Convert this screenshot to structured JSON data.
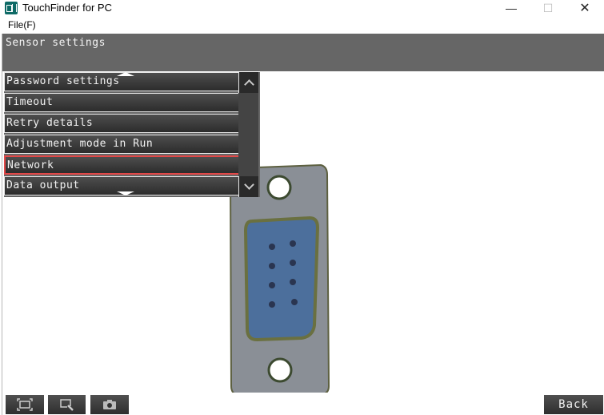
{
  "window": {
    "title": "TouchFinder for PC",
    "icon": "touchfinder-app-icon",
    "controls": {
      "minimize": "—",
      "maximize": "☐",
      "close": "✕"
    }
  },
  "menubar": {
    "file_label": "File(F)"
  },
  "header": {
    "title": "Sensor settings"
  },
  "menu_list": {
    "items": [
      {
        "label": "Password settings",
        "selected": false
      },
      {
        "label": "Timeout",
        "selected": false
      },
      {
        "label": "Retry details",
        "selected": false
      },
      {
        "label": "Adjustment mode in Run",
        "selected": false
      },
      {
        "label": "Network",
        "selected": true
      },
      {
        "label": "Data output",
        "selected": false
      }
    ],
    "scroll_up_icon": "chevron-up-icon",
    "scroll_down_icon": "chevron-down-icon"
  },
  "camera": {
    "subject": "DB9 serial connector image"
  },
  "toolbar": {
    "fit_icon": "fit-screen-icon",
    "zoom_icon": "zoom-area-icon",
    "capture_icon": "camera-icon",
    "back_label": "Back"
  },
  "colors": {
    "selection_border": "#e24848",
    "header_bg": "#666666",
    "app_icon": "#0e6a66"
  }
}
